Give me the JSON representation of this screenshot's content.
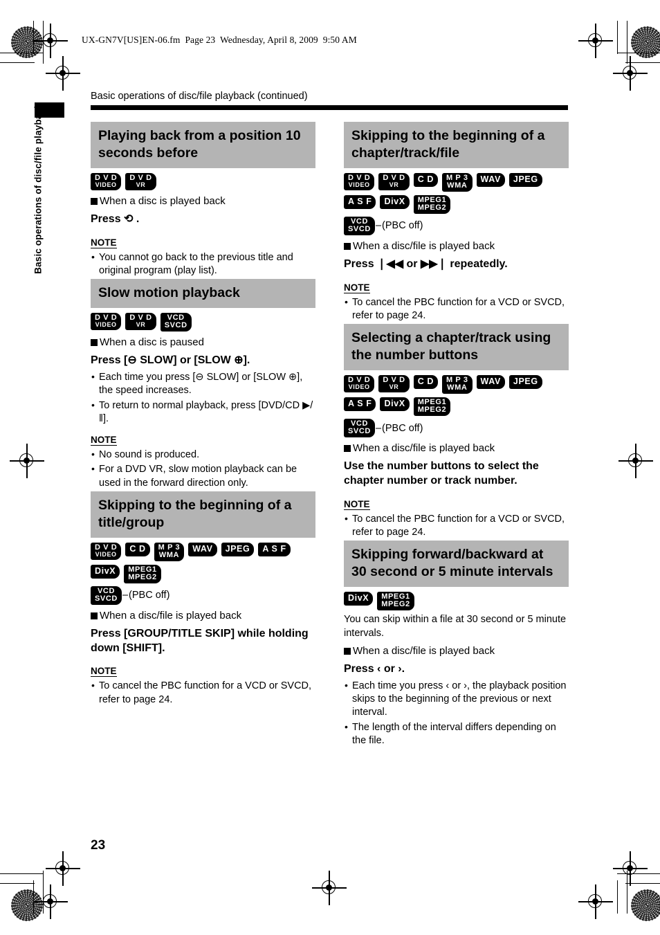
{
  "print_marks": {
    "note": "registration crosshairs and halftone patches at page corners"
  },
  "file_header": "UX-GN7V[US]EN-06.fm  Page 23  Wednesday, April 8, 2009  9:50 AM",
  "side_tab": {
    "label": "Basic operations of disc/file playback"
  },
  "breadcrumb": "Basic operations of disc/file playback (continued)",
  "page_number": "23",
  "labels": {
    "note": "NOTE",
    "pbc_off": "(PBC off)",
    "dash": "–"
  },
  "badge_text": {
    "dvd_video": [
      "D V D",
      "VIDEO"
    ],
    "dvd_vr": [
      "D V D",
      "VR"
    ],
    "vcd_svcd": [
      "VCD",
      "SVCD"
    ],
    "cd": [
      "C D"
    ],
    "mp3_wma": [
      "M P 3",
      "WMA"
    ],
    "wav": [
      "WAV"
    ],
    "jpeg": [
      "JPEG"
    ],
    "asf": [
      "A S F"
    ],
    "divx": [
      "DivX"
    ],
    "mpeg": [
      "MPEG1",
      "MPEG2"
    ]
  },
  "left_column": [
    {
      "id": "playing-back-10-seconds",
      "heading": "Playing back from a position 10 seconds before",
      "badges": [
        "dvd_video",
        "dvd_vr"
      ],
      "pbc": false,
      "condition": "When a disc is played back",
      "press": "Press ⟲ .",
      "paragraph": null,
      "bullets": [],
      "note_bullets": [
        "You cannot go back to the previous title and original program (play list)."
      ]
    },
    {
      "id": "slow-motion-playback",
      "heading": "Slow motion playback",
      "badges": [
        "dvd_video",
        "dvd_vr",
        "vcd_svcd"
      ],
      "pbc": false,
      "condition": "When a disc is paused",
      "press": "Press [⊖ SLOW] or [SLOW ⊕].",
      "paragraph": null,
      "bullets": [
        "Each time you press [⊖ SLOW] or [SLOW ⊕], the speed increases.",
        "To return to normal playback, press [DVD/CD ▶/‖]."
      ],
      "note_bullets": [
        "No sound is produced.",
        "For a DVD VR, slow motion playback can be used in the forward direction only."
      ]
    },
    {
      "id": "skipping-title-group",
      "heading": "Skipping to the beginning of a title/group",
      "badges": [
        "dvd_video",
        "cd",
        "mp3_wma",
        "wav",
        "jpeg",
        "asf",
        "divx",
        "mpeg"
      ],
      "pbc": true,
      "condition": "When a disc/file is played back",
      "press": "Press [GROUP/TITLE SKIP] while holding down [SHIFT].",
      "paragraph": null,
      "bullets": [],
      "note_bullets": [
        "To cancel the PBC function for a VCD or SVCD, refer to page 24."
      ]
    }
  ],
  "right_column": [
    {
      "id": "skipping-chapter-track-file",
      "heading": "Skipping to the beginning of a chapter/track/file",
      "badges": [
        "dvd_video",
        "dvd_vr",
        "cd",
        "mp3_wma",
        "wav",
        "jpeg",
        "asf",
        "divx",
        "mpeg"
      ],
      "pbc": true,
      "condition": "When a disc/file is played back",
      "press": "Press ❘◀◀ or ▶▶❘ repeatedly.",
      "paragraph": null,
      "bullets": [],
      "note_bullets": [
        "To cancel the PBC function for a VCD or SVCD, refer to page 24."
      ]
    },
    {
      "id": "selecting-chapter-track-number",
      "heading": "Selecting a chapter/track using the number buttons",
      "badges": [
        "dvd_video",
        "dvd_vr",
        "cd",
        "mp3_wma",
        "wav",
        "jpeg",
        "asf",
        "divx",
        "mpeg"
      ],
      "pbc": true,
      "condition": "When a disc/file is played back",
      "press": "Use the number buttons to select the chapter number or track number.",
      "paragraph": null,
      "bullets": [],
      "note_bullets": [
        "To cancel the PBC function for a VCD or SVCD, refer to page 24."
      ]
    },
    {
      "id": "skipping-intervals",
      "heading": "Skipping forward/backward at 30 second or 5 minute intervals",
      "badges": [
        "divx",
        "mpeg"
      ],
      "pbc": false,
      "condition": "When a disc/file is played back",
      "press": "Press ‹ or ›.",
      "paragraph": "You can skip within a file at 30 second or 5 minute intervals.",
      "bullets": [
        "Each time you press ‹ or ›, the playback position skips to the beginning of the previous or next interval.",
        "The length of the interval differs depending on the file."
      ],
      "note_bullets": []
    }
  ]
}
